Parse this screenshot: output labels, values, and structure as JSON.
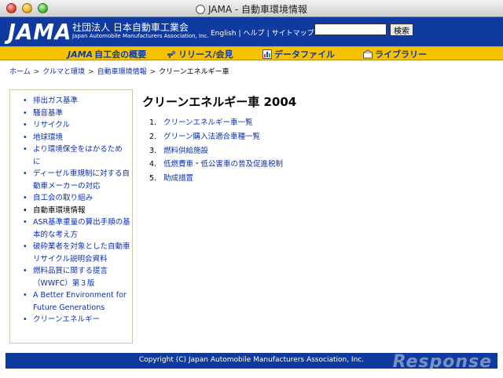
{
  "window": {
    "title": "JAMA - 自動車環境情報"
  },
  "header": {
    "logo": "JAMA",
    "org_name_jp": "社団法人 日本自動車工業会",
    "org_name_en": "Japan Automobile Manufacturers Association, Inc.",
    "links": [
      "English",
      "ヘルプ",
      "サイトマップ"
    ],
    "search": {
      "value": "",
      "button_label": "検索"
    }
  },
  "nav": {
    "items": [
      {
        "prefix": "JAMA",
        "label": "自工会の概要",
        "icon": "jama-logo-icon"
      },
      {
        "label": "リリース/会見",
        "icon": "microphone-icon"
      },
      {
        "label": "データファイル",
        "icon": "chart-file-icon"
      },
      {
        "label": "ライブラリー",
        "icon": "books-icon"
      }
    ]
  },
  "breadcrumb": {
    "items": [
      "ホーム",
      "クルマと環境",
      "自動車環境情報",
      "クリーンエネルギー車"
    ],
    "separator": ">"
  },
  "sidebar": {
    "bullet": "•",
    "items": [
      {
        "label": "排出ガス基準"
      },
      {
        "label": "騒音基準"
      },
      {
        "label": "リサイクル"
      },
      {
        "label": "地球環境"
      },
      {
        "label": "より環境保全をはかるため に"
      },
      {
        "label": "ディーゼル車規制に対する自動車メーカーの対応"
      },
      {
        "label": "自工会の取り組み"
      },
      {
        "label": "自動車環境情報"
      },
      {
        "label": "ASR基準重量の算出手順の基本的な考え方"
      },
      {
        "label": "破砕業者を対象とした自動車リサイクル説明会資料"
      },
      {
        "label": "燃料品質に関する提言 （WWFC）第３版"
      },
      {
        "label": "A Better Environment for Future Generations"
      },
      {
        "label": "クリーンエネルギー"
      }
    ]
  },
  "main": {
    "title": "クリーンエネルギー車 2004",
    "items": [
      {
        "num": "1.",
        "label": "クリーンエネルギー車一覧"
      },
      {
        "num": "2.",
        "label": "グリーン購入法適合車種一覧"
      },
      {
        "num": "3.",
        "label": "燃料供給施設"
      },
      {
        "num": "4.",
        "label": "低燃費車・低公害車の普及促進税制"
      },
      {
        "num": "5.",
        "label": "助成措置"
      }
    ]
  },
  "footer": {
    "copyright": "Copyright (C) Japan Automobile Manufacturers Association, Inc."
  },
  "watermark": "Response",
  "colors": {
    "header_blue": "#0f3aa0",
    "nav_yellow": "#f5c200",
    "link_blue": "#0b2fb0"
  }
}
